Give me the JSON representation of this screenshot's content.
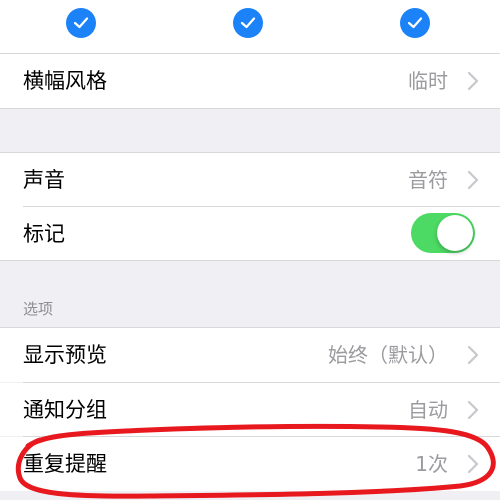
{
  "top_checks": [
    {
      "icon": "checkmark-icon",
      "checked": true
    },
    {
      "icon": "checkmark-icon",
      "checked": true
    },
    {
      "icon": "checkmark-icon",
      "checked": true
    }
  ],
  "banner_style": {
    "label": "横幅风格",
    "value": "临时"
  },
  "sound": {
    "label": "声音",
    "value": "音符"
  },
  "badge": {
    "label": "标记",
    "toggle_on": true
  },
  "options": {
    "section_title": "选项",
    "show_preview": {
      "label": "显示预览",
      "value": "始终（默认）"
    },
    "grouping": {
      "label": "通知分组",
      "value": "自动"
    },
    "repeat": {
      "label": "重复提醒",
      "value": "1次"
    }
  },
  "colors": {
    "accent_blue": "#1b82f7",
    "toggle_green": "#4cd964",
    "annotation_red": "#e8191e"
  }
}
